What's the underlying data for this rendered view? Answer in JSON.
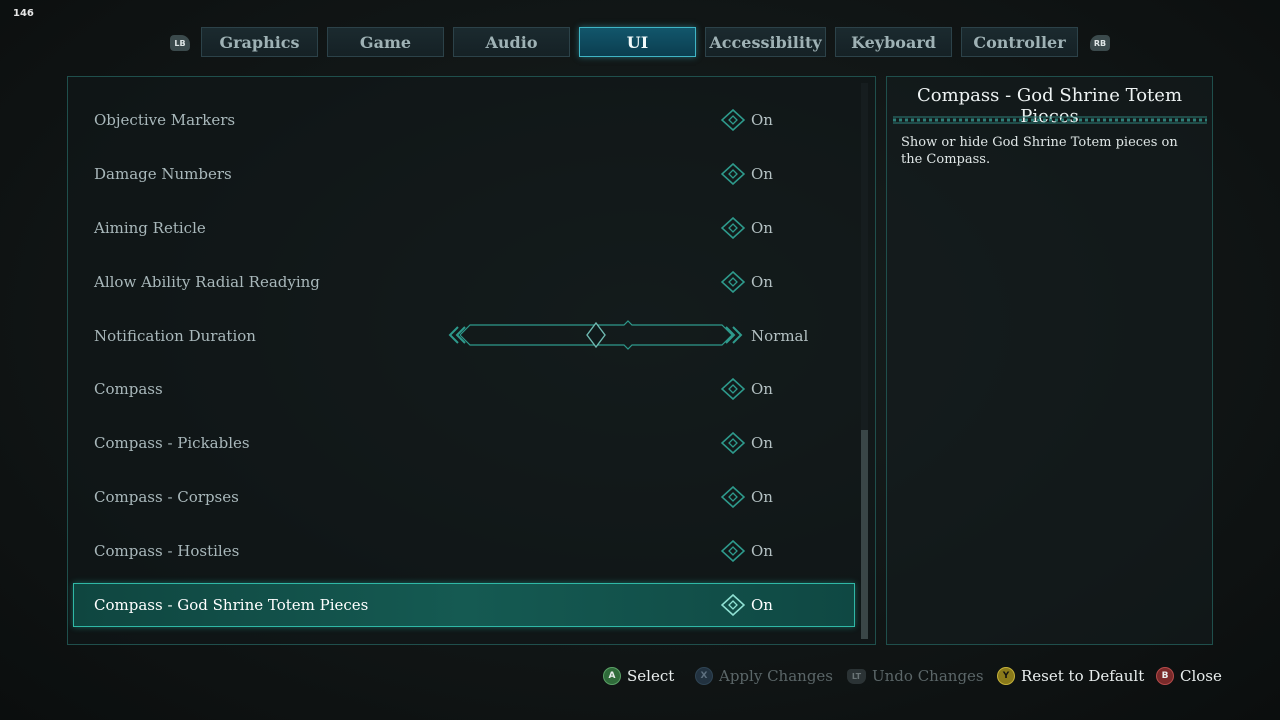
{
  "fps": "146",
  "tabs": {
    "left_bumper": "LB",
    "right_bumper": "RB",
    "items": [
      {
        "label": "Graphics"
      },
      {
        "label": "Game"
      },
      {
        "label": "Audio"
      },
      {
        "label": "UI",
        "active": true
      },
      {
        "label": "Accessibility"
      },
      {
        "label": "Keyboard"
      },
      {
        "label": "Controller"
      }
    ]
  },
  "settings": [
    {
      "label": "Objective Markers",
      "value": "On"
    },
    {
      "label": "Damage Numbers",
      "value": "On"
    },
    {
      "label": "Aiming Reticle",
      "value": "On"
    },
    {
      "label": "Allow Ability Radial Readying",
      "value": "On"
    },
    {
      "label": "Notification Duration",
      "value": "Normal"
    },
    {
      "label": "Compass",
      "value": "On"
    },
    {
      "label": "Compass - Pickables",
      "value": "On"
    },
    {
      "label": "Compass - Corpses",
      "value": "On"
    },
    {
      "label": "Compass - Hostiles",
      "value": "On"
    },
    {
      "label": "Compass - God Shrine Totem Pieces",
      "value": "On",
      "selected": true
    }
  ],
  "description": {
    "title": "Compass - God Shrine Totem Pieces",
    "text": "Show or hide God Shrine Totem pieces on the Compass."
  },
  "footer": {
    "select": {
      "key": "A",
      "label": "Select"
    },
    "apply": {
      "key": "X",
      "label": "Apply Changes"
    },
    "undo": {
      "key": "LT",
      "label": "Undo Changes"
    },
    "reset": {
      "key": "Y",
      "label": "Reset to Default"
    },
    "close": {
      "key": "B",
      "label": "Close"
    }
  },
  "colors": {
    "accent": "#2fb8a6",
    "active_tab": "#12566b"
  }
}
